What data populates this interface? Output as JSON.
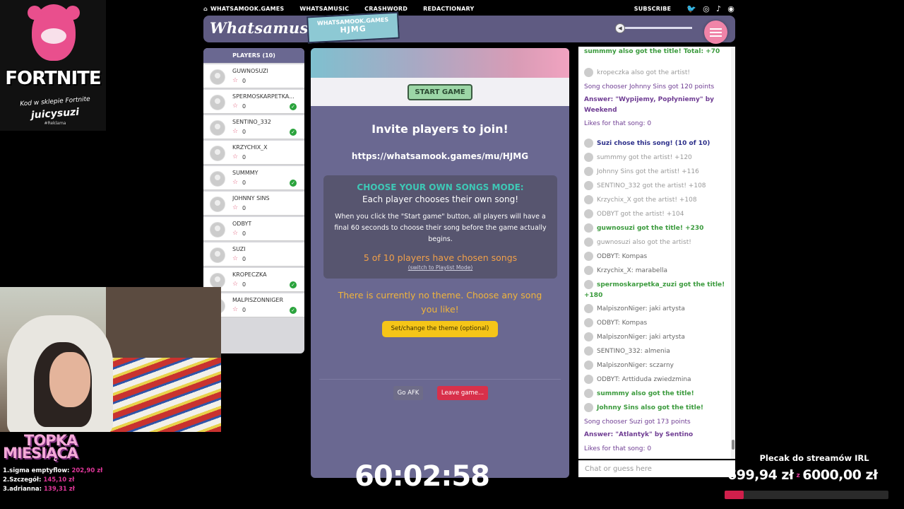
{
  "topnav": {
    "items": [
      "WHATSAMOOK.GAMES",
      "WHATSAMUSIC",
      "CRASHWORD",
      "REDACTIONARY"
    ],
    "subscribe": "SUBSCRIBE",
    "social_icons": [
      "twitter-icon",
      "instagram-icon",
      "tiktok-icon",
      "discord-icon"
    ]
  },
  "header": {
    "logo": "Whatsamusic",
    "room_label": "WHATSAMOOK.GAMES",
    "room_code": "HJMG",
    "volume_icon": "speaker-icon"
  },
  "players": {
    "title": "PLAYERS (10)",
    "list": [
      {
        "name": "GUWNOSUZI",
        "score": "0",
        "chosen": false
      },
      {
        "name": "SPERMOSKARPETKA...",
        "score": "0",
        "chosen": true
      },
      {
        "name": "SENTINO_332",
        "score": "0",
        "chosen": true
      },
      {
        "name": "KRZYCHIX_X",
        "score": "0",
        "chosen": false
      },
      {
        "name": "SUMMMY",
        "score": "0",
        "chosen": true
      },
      {
        "name": "JOHNNY SINS",
        "score": "0",
        "chosen": false
      },
      {
        "name": "ODBYT",
        "score": "0",
        "chosen": false
      },
      {
        "name": "SUZI",
        "score": "0",
        "chosen": false
      },
      {
        "name": "KROPECZKA",
        "score": "0",
        "chosen": true
      },
      {
        "name": "MALPISZONNIGER",
        "score": "0",
        "chosen": true
      }
    ]
  },
  "main": {
    "start_button": "START GAME",
    "invite_title": "Invite players to join!",
    "invite_url": "https://whatsamook.games/mu/HJMG",
    "mode_title": "CHOOSE YOUR OWN SONGS MODE:",
    "mode_subtitle": "Each player chooses their own song!",
    "mode_desc": "When you click the \"Start game\" button, all players will have a final 60 seconds to choose their song before the game actually begins.",
    "chosen_count": "5 of 10 players have chosen songs",
    "switch_link": "(switch to Playlist Mode)",
    "theme_text": "There is currently no theme. Choose any song you like!",
    "theme_button": "Set/change the theme (optional)",
    "afk_button": "Go AFK",
    "leave_button": "Leave game..."
  },
  "chat": {
    "placeholder": "Chat or guess here",
    "messages": [
      {
        "text": "summmy also got the title! Total: +70",
        "style": "bg",
        "avatar": false
      },
      {
        "text": "kropeczka also got the artist!",
        "style": "g",
        "avatar": true
      },
      {
        "text": "Song chooser Johnny Sins got 120 points",
        "style": "pu",
        "avatar": false
      },
      {
        "text": "Answer: \"Wypijemy, Popłyniemy\" by Weekend",
        "style": "pb",
        "avatar": false
      },
      {
        "text": "Likes for that song: 0",
        "style": "pu",
        "avatar": false
      },
      {
        "text": "Suzi chose this song! (10 of 10)",
        "style": "nb",
        "avatar": true
      },
      {
        "text": "summmy got the artist! +120",
        "style": "g",
        "avatar": true
      },
      {
        "text": "Johnny Sins got the artist! +116",
        "style": "g",
        "avatar": true
      },
      {
        "text": "SENTINO_332 got the artist! +108",
        "style": "g",
        "avatar": true
      },
      {
        "text": "Krzychix_X got the artist! +108",
        "style": "g",
        "avatar": true
      },
      {
        "text": "ODBYT got the artist! +104",
        "style": "g",
        "avatar": true
      },
      {
        "text": "guwnosuzi got the title! +230",
        "style": "bg",
        "avatar": true
      },
      {
        "text": "guwnosuzi also got the artist!",
        "style": "g",
        "avatar": true
      },
      {
        "text": "ODBYT: Kompas",
        "style": "dk",
        "avatar": true
      },
      {
        "text": "Krzychix_X: marabella",
        "style": "dk",
        "avatar": true
      },
      {
        "text": "spermoskarpetka_zuzi got the title! +180",
        "style": "bg",
        "avatar": true
      },
      {
        "text": "MalpiszonNiger: jaki artysta",
        "style": "dk",
        "avatar": true
      },
      {
        "text": "ODBYT: Kompas",
        "style": "dk",
        "avatar": true
      },
      {
        "text": "MalpiszonNiger: jaki artysta",
        "style": "dk",
        "avatar": true
      },
      {
        "text": "SENTINO_332: almenia",
        "style": "dk",
        "avatar": true
      },
      {
        "text": "MalpiszonNiger: sczarny",
        "style": "dk",
        "avatar": true
      },
      {
        "text": "ODBYT: Arttiduda zwiedzmina",
        "style": "dk",
        "avatar": true
      },
      {
        "text": "summmy also got the title!",
        "style": "bg",
        "avatar": true
      },
      {
        "text": "Johnny Sins also got the title!",
        "style": "bg",
        "avatar": true
      },
      {
        "text": "Song chooser Suzi got 173 points",
        "style": "pu",
        "avatar": false
      },
      {
        "text": "Answer: \"Atlantyk\" by Sentino",
        "style": "pb",
        "avatar": false
      },
      {
        "text": "Likes for that song: 0",
        "style": "pu",
        "avatar": false
      }
    ]
  },
  "overlay": {
    "fortnite_logo": "FORTNITE",
    "fortnite_line1": "Kod w sklepie Fortnite",
    "fortnite_line2": "juicysuzi",
    "fortnite_line3": "#Reklama",
    "topka_1": "TOPKA",
    "topka_2": "MIESIĄCA",
    "top_list": [
      {
        "name": "1.sigma emptyflow:",
        "amount": "202,90 zł"
      },
      {
        "name": "2.Szczegół:",
        "amount": "145,10 zł"
      },
      {
        "name": "3.adrianna:",
        "amount": "139,31 zł"
      }
    ],
    "timer": "60:02:58",
    "goal_title": "Plecak do streamów IRL",
    "goal_current": "699,94 zł",
    "goal_sep": "z",
    "goal_target": "6000,00 zł",
    "goal_progress": 0.117
  }
}
